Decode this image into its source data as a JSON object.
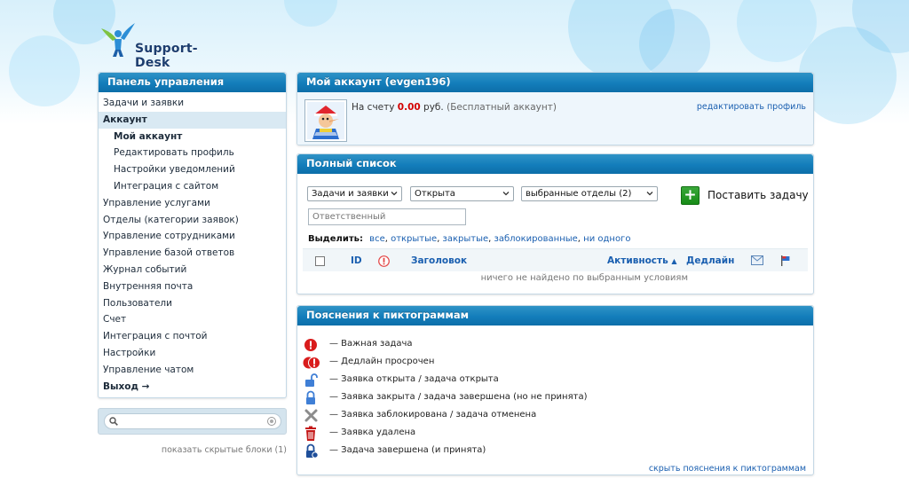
{
  "logo": {
    "text": "Support-Desk"
  },
  "sidebar": {
    "title": "Панель управления",
    "items": [
      {
        "label": "Задачи и заявки"
      },
      {
        "label": "Аккаунт"
      },
      {
        "label": "Мой аккаунт"
      },
      {
        "label": "Редактировать профиль"
      },
      {
        "label": "Настройки уведомлений"
      },
      {
        "label": "Интеграция с сайтом"
      },
      {
        "label": "Управление услугами"
      },
      {
        "label": "Отделы (категории заявок)"
      },
      {
        "label": "Управление сотрудниками"
      },
      {
        "label": "Управление базой ответов"
      },
      {
        "label": "Журнал событий"
      },
      {
        "label": "Внутренняя почта"
      },
      {
        "label": "Пользователи"
      },
      {
        "label": "Счет"
      },
      {
        "label": "Интеграция с почтой"
      },
      {
        "label": "Настройки"
      },
      {
        "label": "Управление чатом"
      },
      {
        "label": "Выход →"
      }
    ],
    "search": {
      "value": ""
    },
    "hidden_blocks": "показать скрытые блоки (1)"
  },
  "account": {
    "title": "Мой аккаунт (evgen196)",
    "balance_prefix": "На счету",
    "balance_amount": "0.00",
    "balance_currency": "руб.",
    "account_type": "(Бесплатный аккаунт)",
    "edit_profile": "редактировать профиль"
  },
  "full_list": {
    "title": "Полный список",
    "filter_type": "Задачи и заявки",
    "filter_status": "Открыта",
    "filter_departments": "выбранные отделы (2)",
    "add_task": "Поставить задачу",
    "responsible_placeholder": "Ответственный",
    "select_label": "Выделить:",
    "select_all": "все",
    "select_open": "открытые",
    "select_closed": "закрытые",
    "select_blocked": "заблокированные",
    "select_none": "ни одного",
    "col_id": "ID",
    "col_title": "Заголовок",
    "col_activity": "Активность",
    "col_deadline": "Дедлайн",
    "empty_message": "ничего не найдено по выбранным условиям"
  },
  "legend": {
    "title": "Пояснения к пиктограммам",
    "items": [
      {
        "icon": "important-icon",
        "text": "— Важная задача"
      },
      {
        "icon": "deadline-overdue-icon",
        "text": "— Дедлайн просрочен"
      },
      {
        "icon": "lock-open-icon",
        "text": "— Заявка открыта / задача открыта"
      },
      {
        "icon": "lock-closed-icon",
        "text": "— Заявка закрыта / задача завершена (но не принята)"
      },
      {
        "icon": "cross-icon",
        "text": "— Заявка заблокирована / задача отменена"
      },
      {
        "icon": "trash-icon",
        "text": "— Заявка удалена"
      },
      {
        "icon": "lock-accepted-icon",
        "text": "— Задача завершена (и принята)"
      }
    ],
    "hide_link": "скрыть пояснения к пиктограммам"
  },
  "colors": {
    "header_blue": "#137dbb",
    "link_blue": "#1a5fb0",
    "amount_red": "#d30000",
    "add_green": "#178c17"
  }
}
